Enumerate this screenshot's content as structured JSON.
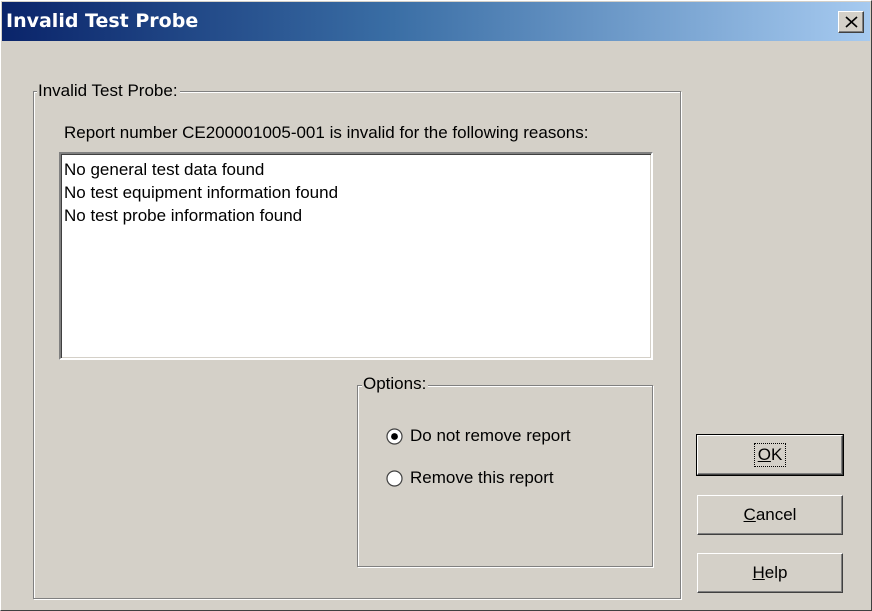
{
  "window": {
    "title": "Invalid Test Probe"
  },
  "group": {
    "legend": "Invalid Test Probe:",
    "report_message": "Report number CE200001005-001 is invalid for the following reasons:"
  },
  "reasons": [
    "No general test data found",
    "No test equipment information found",
    "No test probe information found"
  ],
  "options": {
    "legend": "Options:",
    "choices": [
      {
        "label": "Do not remove report",
        "selected": true
      },
      {
        "label": "Remove this report",
        "selected": false
      }
    ]
  },
  "buttons": {
    "ok": {
      "mnemonic": "O",
      "rest": "K"
    },
    "cancel": {
      "mnemonic": "C",
      "rest": "ancel"
    },
    "help": {
      "mnemonic": "H",
      "rest": "elp"
    }
  },
  "icons": {
    "close": "close-icon",
    "radio_selected": "radio-selected-icon",
    "radio_unselected": "radio-unselected-icon"
  }
}
